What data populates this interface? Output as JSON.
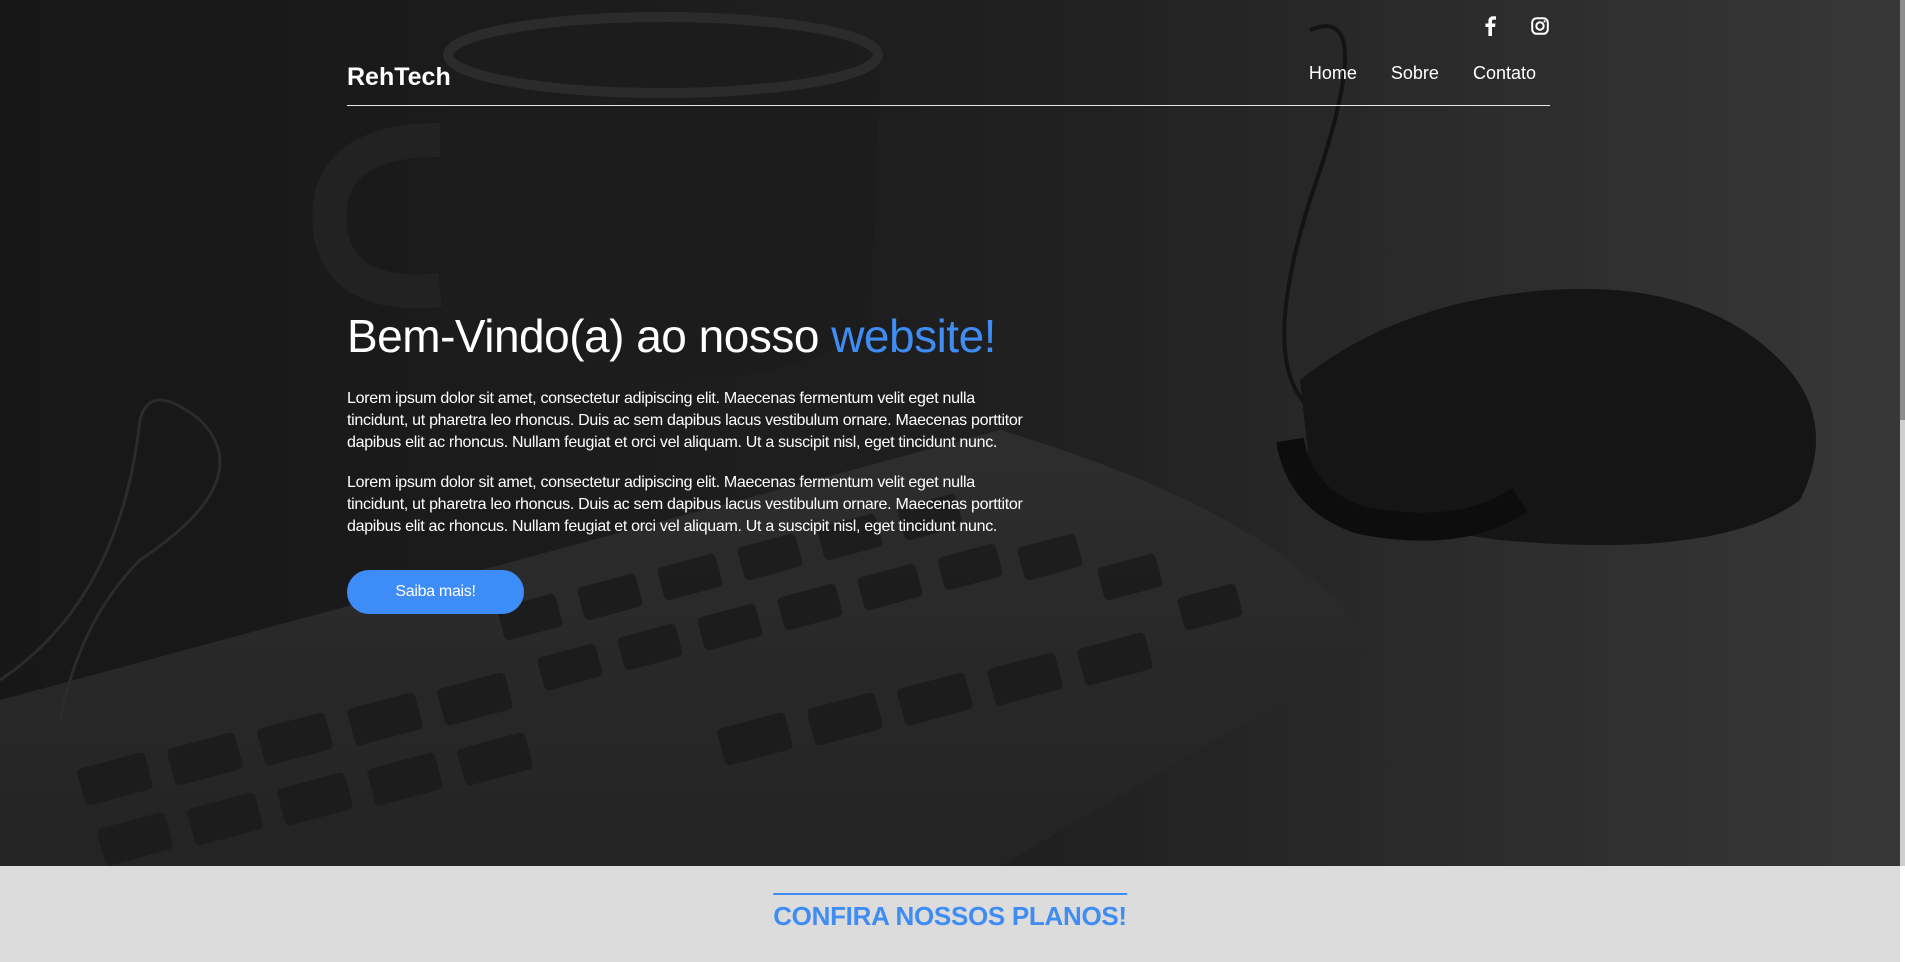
{
  "brand": {
    "name": "RehTech"
  },
  "social": [
    {
      "icon": "facebook-icon"
    },
    {
      "icon": "instagram-icon"
    }
  ],
  "nav": {
    "items": [
      {
        "label": "Home"
      },
      {
        "label": "Sobre"
      },
      {
        "label": "Contato"
      }
    ]
  },
  "hero": {
    "title_main": "Bem-Vindo(a) ao nosso ",
    "title_accent": "website!",
    "paragraphs": [
      "Lorem ipsum dolor sit amet, consectetur adipiscing elit. Maecenas fermentum velit eget nulla tincidunt, ut pharetra leo rhoncus. Duis ac sem dapibus lacus vestibulum ornare. Maecenas porttitor dapibus elit ac rhoncus. Nullam feugiat et orci vel aliquam. Ut a suscipit nisl, eget tincidunt nunc.",
      "Lorem ipsum dolor sit amet, consectetur adipiscing elit. Maecenas fermentum velit eget nulla tincidunt, ut pharetra leo rhoncus. Duis ac sem dapibus lacus vestibulum ornare. Maecenas porttitor dapibus elit ac rhoncus. Nullam feugiat et orci vel aliquam. Ut a suscipit nisl, eget tincidunt nunc."
    ],
    "cta_label": "Saiba mais!"
  },
  "plans": {
    "title": "CONFIRA NOSSOS PLANOS!"
  },
  "colors": {
    "accent": "#3f8cf3",
    "button": "#3d8cf7",
    "section_bg": "#dcdcdc"
  }
}
